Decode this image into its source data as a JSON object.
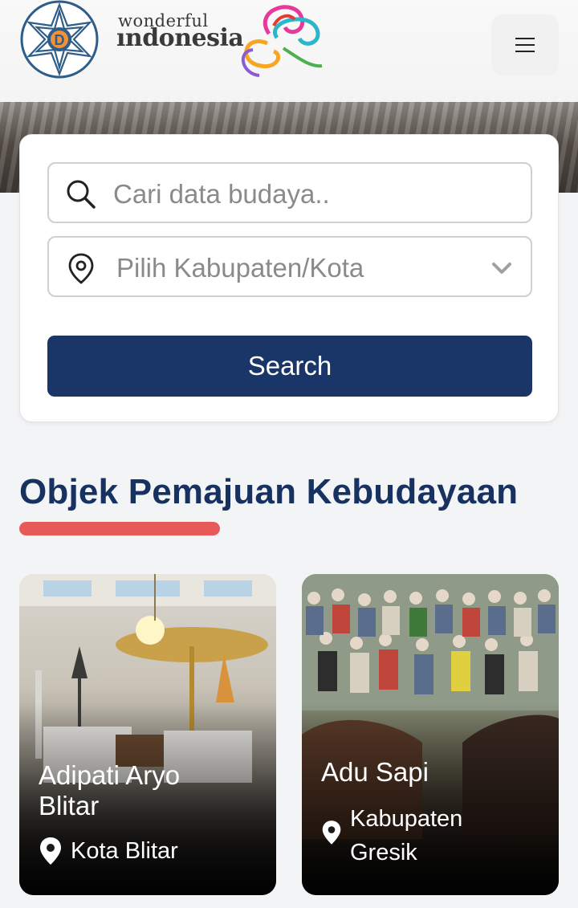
{
  "header": {
    "logo_text": "D",
    "brand_small": "wonderful",
    "brand_big": "ındonesia",
    "menu_icon": "hamburger-icon"
  },
  "search": {
    "keyword_placeholder": "Cari data budaya..",
    "region_placeholder": "Pilih Kabupaten/Kota",
    "button_label": "Search",
    "icons": {
      "keyword": "search-icon",
      "region": "location-pin-icon",
      "dropdown": "chevron-down-icon"
    }
  },
  "section": {
    "title": "Objek Pemajuan Kebudayaan",
    "accent_color": "#e85a5a",
    "title_color": "#173261"
  },
  "cards": [
    {
      "title_line1": "Adipati Aryo",
      "title_line2": "Blitar",
      "location_line1": "Kota Blitar",
      "location_line2": ""
    },
    {
      "title_line1": "Adu Sapi",
      "title_line2": "",
      "location_line1": "Kabupaten",
      "location_line2": "Gresik"
    }
  ],
  "colors": {
    "primary": "#1a3567",
    "background": "#f3f4f6"
  }
}
